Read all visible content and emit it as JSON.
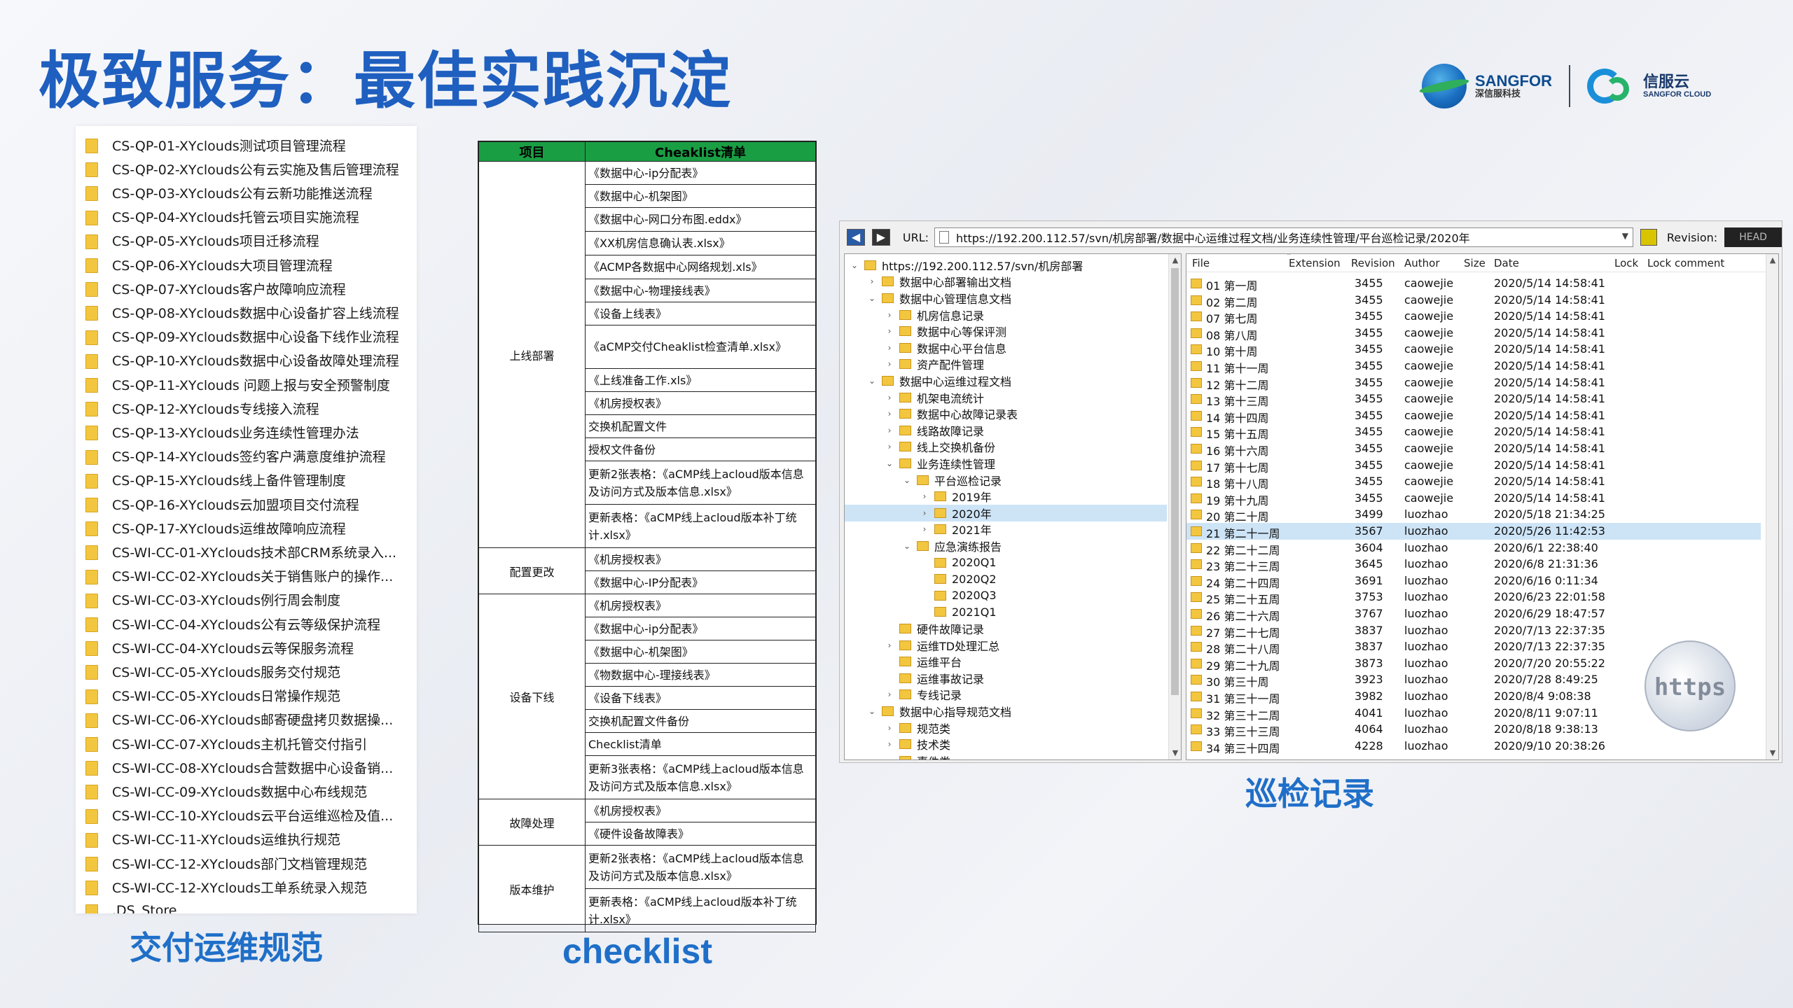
{
  "title": "极致服务：最佳实践沉淀",
  "logos": {
    "sangfor_name": "SANGFOR",
    "sangfor_sub": "深信服科技",
    "cloud_name": "信服云",
    "cloud_sub": "SANGFOR CLOUD"
  },
  "files": [
    "CS-QP-01-XYclouds测试项目管理流程",
    "CS-QP-02-XYclouds公有云实施及售后管理流程",
    "CS-QP-03-XYclouds公有云新功能推送流程",
    "CS-QP-04-XYclouds托管云项目实施流程",
    "CS-QP-05-XYclouds项目迁移流程",
    "CS-QP-06-XYclouds大项目管理流程",
    "CS-QP-07-XYclouds客户故障响应流程",
    "CS-QP-08-XYclouds数据中心设备扩容上线流程",
    "CS-QP-09-XYclouds数据中心设备下线作业流程",
    "CS-QP-10-XYclouds数据中心设备故障处理流程",
    "CS-QP-11-XYclouds 问题上报与安全预警制度",
    "CS-QP-12-XYclouds专线接入流程",
    "CS-QP-13-XYclouds业务连续性管理办法",
    "CS-QP-14-XYclouds签约客户满意度维护流程",
    "CS-QP-15-XYclouds线上备件管理制度",
    "CS-QP-16-XYclouds云加盟项目交付流程",
    "CS-QP-17-XYclouds运维故障响应流程",
    "CS-WI-CC-01-XYclouds技术部CRM系统录入...",
    "CS-WI-CC-02-XYclouds关于销售账户的操作...",
    "CS-WI-CC-03-XYclouds例行周会制度",
    "CS-WI-CC-04-XYclouds公有云等级保护流程",
    "CS-WI-CC-04-XYclouds云等保服务流程",
    "CS-WI-CC-05-XYclouds服务交付规范",
    "CS-WI-CC-05-XYclouds日常操作规范",
    "CS-WI-CC-06-XYclouds邮寄硬盘拷贝数据操...",
    "CS-WI-CC-07-XYclouds主机托管交付指引",
    "CS-WI-CC-08-XYclouds合营数据中心设备销...",
    "CS-WI-CC-09-XYclouds数据中心布线规范",
    "CS-WI-CC-10-XYclouds云平台运维巡检及值...",
    "CS-WI-CC-11-XYclouds运维执行规范",
    "CS-WI-CC-12-XYclouds部门文档管理规范",
    "CS-WI-CC-12-XYclouds工单系统录入规范",
    ".DS_Store"
  ],
  "captions": {
    "files": "交付运维规范",
    "checklist": "checklist",
    "svn": "巡检记录"
  },
  "checklist": {
    "header_col1": "项目",
    "header_col2": "Cheaklist清单",
    "groups": [
      {
        "category": "上线部署",
        "items": [
          "《数据中心-ip分配表》",
          "《数据中心-机架图》",
          "《数据中心-网口分布图.eddx》",
          "《XX机房信息确认表.xlsx》",
          "《ACMP各数据中心网络规划.xls》",
          "《数据中心-物理接线表》",
          "《设备上线表》",
          "《aCMP交付Cheaklist检查清单.xlsx》",
          "《上线准备工作.xls》",
          "《机房授权表》",
          "交换机配置文件",
          "授权文件备份",
          "更新2张表格：《aCMP线上acloud版本信息及访问方式及版本信息.xlsx》",
          "更新表格：《aCMP线上acloud版本补丁统计.xlsx》"
        ]
      },
      {
        "category": "配置更改",
        "items": [
          "《机房授权表》",
          "《数据中心-IP分配表》"
        ]
      },
      {
        "category": "设备下线",
        "items": [
          "《机房授权表》",
          "《数据中心-ip分配表》",
          "《数据中心-机架图》",
          "《物数据中心-理接线表》",
          "《设备下线表》",
          "交换机配置文件备份",
          "Checklist清单",
          "更新3张表格：《aCMP线上acloud版本信息及访问方式及版本信息.xlsx》"
        ]
      },
      {
        "category": "故障处理",
        "items": [
          "《机房授权表》",
          "《硬件设备故障表》"
        ]
      },
      {
        "category": "版本维护",
        "items": [
          "更新2张表格：《aCMP线上acloud版本信息及访问方式及版本信息.xlsx》",
          "更新表格：《aCMP线上acloud版本补丁统计.xlsx》"
        ]
      }
    ]
  },
  "svn": {
    "url_label": "URL:",
    "url": "https://192.200.112.57/svn/机房部署/数据中心运维过程文档/业务连续性管理/平台巡检记录/2020年",
    "revision_label": "Revision:",
    "revision_value": "HEAD",
    "tree": [
      {
        "level": 0,
        "arrow": "⌄",
        "label": "https://192.200.112.57/svn/机房部署"
      },
      {
        "level": 1,
        "arrow": "›",
        "label": "数据中心部署输出文档"
      },
      {
        "level": 1,
        "arrow": "⌄",
        "label": "数据中心管理信息文档"
      },
      {
        "level": 2,
        "arrow": "›",
        "label": "机房信息记录"
      },
      {
        "level": 2,
        "arrow": "›",
        "label": "数据中心等保评测"
      },
      {
        "level": 2,
        "arrow": "›",
        "label": "数据中心平台信息"
      },
      {
        "level": 2,
        "arrow": "›",
        "label": "资产配件管理"
      },
      {
        "level": 1,
        "arrow": "⌄",
        "label": "数据中心运维过程文档"
      },
      {
        "level": 2,
        "arrow": "›",
        "label": "机架电流统计"
      },
      {
        "level": 2,
        "arrow": "›",
        "label": "数据中心故障记录表"
      },
      {
        "level": 2,
        "arrow": "›",
        "label": "线路故障记录"
      },
      {
        "level": 2,
        "arrow": "›",
        "label": "线上交换机备份"
      },
      {
        "level": 2,
        "arrow": "⌄",
        "label": "业务连续性管理"
      },
      {
        "level": 3,
        "arrow": "⌄",
        "label": "平台巡检记录"
      },
      {
        "level": 4,
        "arrow": "›",
        "label": "2019年"
      },
      {
        "level": 4,
        "arrow": "›",
        "label": "2020年",
        "selected": true
      },
      {
        "level": 4,
        "arrow": "›",
        "label": "2021年"
      },
      {
        "level": 3,
        "arrow": "⌄",
        "label": "应急演练报告"
      },
      {
        "level": 4,
        "arrow": "",
        "label": "2020Q1"
      },
      {
        "level": 4,
        "arrow": "",
        "label": "2020Q2"
      },
      {
        "level": 4,
        "arrow": "",
        "label": "2020Q3"
      },
      {
        "level": 4,
        "arrow": "",
        "label": "2021Q1"
      },
      {
        "level": 2,
        "arrow": "",
        "label": "硬件故障记录"
      },
      {
        "level": 2,
        "arrow": "›",
        "label": "运维TD处理汇总"
      },
      {
        "level": 2,
        "arrow": "",
        "label": "运维平台"
      },
      {
        "level": 2,
        "arrow": "",
        "label": "运维事故记录"
      },
      {
        "level": 2,
        "arrow": "›",
        "label": "专线记录"
      },
      {
        "level": 1,
        "arrow": "⌄",
        "label": "数据中心指导规范文档"
      },
      {
        "level": 2,
        "arrow": "›",
        "label": "规范类"
      },
      {
        "level": 2,
        "arrow": "›",
        "label": "技术类"
      },
      {
        "level": 2,
        "arrow": "",
        "label": "事件类"
      }
    ],
    "columns": {
      "file": "File",
      "extension": "Extension",
      "revision": "Revision",
      "author": "Author",
      "size": "Size",
      "date": "Date",
      "lock": "Lock",
      "lock_comment": "Lock comment"
    },
    "rows": [
      {
        "file": "01 第一周",
        "rev": "3455",
        "author": "caowejie",
        "date": "2020/5/14 14:58:41"
      },
      {
        "file": "02 第二周",
        "rev": "3455",
        "author": "caowejie",
        "date": "2020/5/14 14:58:41"
      },
      {
        "file": "07 第七周",
        "rev": "3455",
        "author": "caowejie",
        "date": "2020/5/14 14:58:41"
      },
      {
        "file": "08 第八周",
        "rev": "3455",
        "author": "caowejie",
        "date": "2020/5/14 14:58:41"
      },
      {
        "file": "10 第十周",
        "rev": "3455",
        "author": "caowejie",
        "date": "2020/5/14 14:58:41"
      },
      {
        "file": "11 第十一周",
        "rev": "3455",
        "author": "caowejie",
        "date": "2020/5/14 14:58:41"
      },
      {
        "file": "12 第十二周",
        "rev": "3455",
        "author": "caowejie",
        "date": "2020/5/14 14:58:41"
      },
      {
        "file": "13 第十三周",
        "rev": "3455",
        "author": "caowejie",
        "date": "2020/5/14 14:58:41"
      },
      {
        "file": "14 第十四周",
        "rev": "3455",
        "author": "caowejie",
        "date": "2020/5/14 14:58:41"
      },
      {
        "file": "15 第十五周",
        "rev": "3455",
        "author": "caowejie",
        "date": "2020/5/14 14:58:41"
      },
      {
        "file": "16 第十六周",
        "rev": "3455",
        "author": "caowejie",
        "date": "2020/5/14 14:58:41"
      },
      {
        "file": "17 第十七周",
        "rev": "3455",
        "author": "caowejie",
        "date": "2020/5/14 14:58:41"
      },
      {
        "file": "18 第十八周",
        "rev": "3455",
        "author": "caowejie",
        "date": "2020/5/14 14:58:41"
      },
      {
        "file": "19 第十九周",
        "rev": "3455",
        "author": "caowejie",
        "date": "2020/5/14 14:58:41"
      },
      {
        "file": "20 第二十周",
        "rev": "3499",
        "author": "luozhao",
        "date": "2020/5/18 21:34:25"
      },
      {
        "file": "21 第二十一周",
        "rev": "3567",
        "author": "luozhao",
        "date": "2020/5/26 11:42:53",
        "selected": true
      },
      {
        "file": "22 第二十二周",
        "rev": "3604",
        "author": "luozhao",
        "date": "2020/6/1 22:38:40"
      },
      {
        "file": "23 第二十三周",
        "rev": "3645",
        "author": "luozhao",
        "date": "2020/6/8 21:31:36"
      },
      {
        "file": "24 第二十四周",
        "rev": "3691",
        "author": "luozhao",
        "date": "2020/6/16 0:11:34"
      },
      {
        "file": "25 第二十五周",
        "rev": "3753",
        "author": "luozhao",
        "date": "2020/6/23 22:01:58"
      },
      {
        "file": "26 第二十六周",
        "rev": "3767",
        "author": "luozhao",
        "date": "2020/6/29 18:47:57"
      },
      {
        "file": "27 第二十七周",
        "rev": "3837",
        "author": "luozhao",
        "date": "2020/7/13 22:37:35"
      },
      {
        "file": "28 第二十八周",
        "rev": "3837",
        "author": "luozhao",
        "date": "2020/7/13 22:37:35"
      },
      {
        "file": "29 第二十九周",
        "rev": "3873",
        "author": "luozhao",
        "date": "2020/7/20 20:55:22"
      },
      {
        "file": "30 第三十周",
        "rev": "3923",
        "author": "luozhao",
        "date": "2020/7/28 8:49:25"
      },
      {
        "file": "31 第三十一周",
        "rev": "3982",
        "author": "luozhao",
        "date": "2020/8/4 9:08:38"
      },
      {
        "file": "32 第三十二周",
        "rev": "4041",
        "author": "luozhao",
        "date": "2020/8/11 9:07:11"
      },
      {
        "file": "33 第三十三周",
        "rev": "4064",
        "author": "luozhao",
        "date": "2020/8/18 9:38:13"
      },
      {
        "file": "34 第三十四周",
        "rev": "4228",
        "author": "luozhao",
        "date": "2020/9/10 20:38:26"
      }
    ],
    "watermark": "https"
  }
}
